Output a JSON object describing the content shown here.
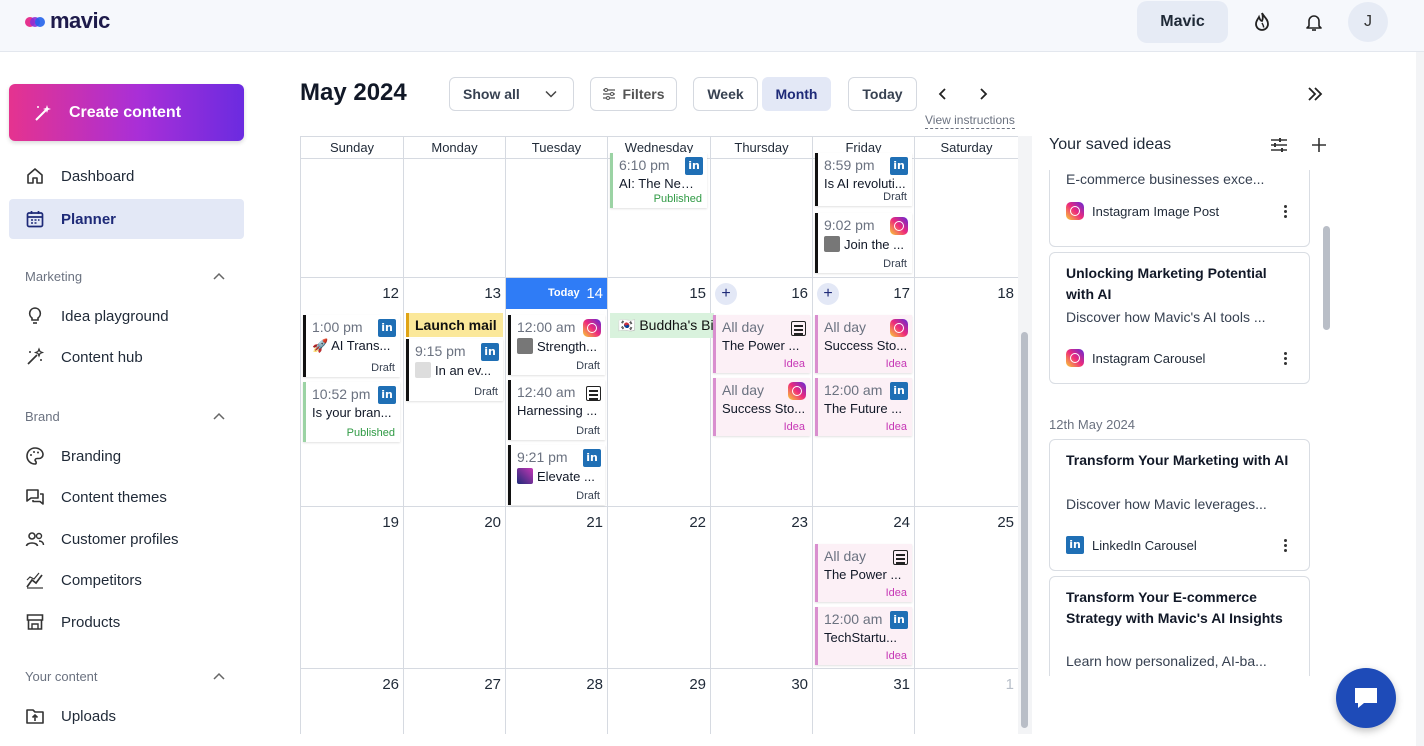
{
  "app": {
    "name": "mavic"
  },
  "topbar": {
    "brand_button": "Mavic",
    "avatar_initial": "J"
  },
  "sidebar": {
    "create_label": "Create content",
    "main_items": [
      {
        "label": "Dashboard"
      },
      {
        "label": "Planner"
      }
    ],
    "sections": [
      {
        "title": "Marketing",
        "items": [
          {
            "label": "Idea playground"
          },
          {
            "label": "Content hub"
          }
        ]
      },
      {
        "title": "Brand",
        "items": [
          {
            "label": "Branding"
          },
          {
            "label": "Content themes"
          },
          {
            "label": "Customer profiles"
          },
          {
            "label": "Competitors"
          },
          {
            "label": "Products"
          }
        ]
      },
      {
        "title": "Your content",
        "items": [
          {
            "label": "Uploads"
          }
        ]
      }
    ]
  },
  "calendar": {
    "title": "May 2024",
    "filter_select": "Show all",
    "filters_label": "Filters",
    "week_label": "Week",
    "month_label": "Month",
    "today_label": "Today",
    "view_instructions": "View instructions",
    "weekdays": [
      "Sunday",
      "Monday",
      "Tuesday",
      "Wednesday",
      "Thursday",
      "Friday",
      "Saturday"
    ],
    "today_tag": "Today",
    "days": {
      "d12": "12",
      "d13": "13",
      "d14": "14",
      "d15": "15",
      "d16": "16",
      "d17": "17",
      "d18": "18",
      "d19": "19",
      "d20": "20",
      "d21": "21",
      "d22": "22",
      "d23": "23",
      "d24": "24",
      "d25": "25",
      "d26": "26",
      "d27": "27",
      "d28": "28",
      "d29": "29",
      "d30": "30",
      "d31": "31",
      "d1": "1"
    },
    "plus": "+",
    "events": {
      "wed_pub": {
        "time": "6:10 pm",
        "title": "AI: The New ...",
        "status": "Published"
      },
      "fri_draft1": {
        "time": "8:59 pm",
        "title": "Is AI revoluti...",
        "status": "Draft"
      },
      "fri_draft2": {
        "time": "9:02 pm",
        "title": "Join the ...",
        "status": "Draft"
      },
      "sun12_a": {
        "time": "1:00 pm",
        "title": "🚀 AI Trans...",
        "status": "Draft"
      },
      "sun12_b": {
        "time": "10:52 pm",
        "title": "Is your bran...",
        "status": "Published"
      },
      "mon13_banner": {
        "title": "Launch mail"
      },
      "mon13_a": {
        "time": "9:15 pm",
        "title": "In an ev...",
        "status": "Draft"
      },
      "tue14_a": {
        "time": "12:00 am",
        "title": "Strength...",
        "status": "Draft"
      },
      "tue14_b": {
        "time": "12:40 am",
        "title": "Harnessing ...",
        "status": "Draft"
      },
      "tue14_c": {
        "time": "9:21 pm",
        "title": "Elevate ...",
        "status": "Draft"
      },
      "wed15_holiday": {
        "title": "🇰🇷 Buddha's Birthday"
      },
      "thu16_a": {
        "time": "All day",
        "title": "The Power ...",
        "status": "Idea"
      },
      "thu16_b": {
        "time": "All day",
        "title": "Success Sto...",
        "status": "Idea"
      },
      "fri17_a": {
        "time": "All day",
        "title": "Success Sto...",
        "status": "Idea"
      },
      "fri17_b": {
        "time": "12:00 am",
        "title": "The Future ...",
        "status": "Idea"
      },
      "fri24_a": {
        "time": "All day",
        "title": "The Power ...",
        "status": "Idea"
      },
      "fri24_b": {
        "time": "12:00 am",
        "title": "TechStartu...",
        "status": "Idea"
      }
    }
  },
  "saved_ideas": {
    "title": "Your saved ideas",
    "cards": [
      {
        "desc": "E-commerce businesses exce...",
        "platform": "Instagram Image Post"
      },
      {
        "title": "Unlocking Marketing Potential with AI",
        "desc": "Discover how Mavic's AI tools ...",
        "platform": "Instagram Carousel"
      },
      {
        "title": "Transform Your Marketing with AI",
        "desc": "Discover how Mavic leverages...",
        "platform": "LinkedIn Carousel"
      },
      {
        "title": "Transform Your E-commerce Strategy with Mavic's AI Insights",
        "desc": "Learn how personalized, AI-ba..."
      }
    ],
    "date_group": "12th May 2024"
  },
  "colors": {
    "accent": "#2f7cf6",
    "nav_active_bg": "#e3e8f6",
    "create_gradient_start": "#e5338f",
    "create_gradient_end": "#6b2be0",
    "linkedin": "#1f6fb5",
    "chat": "#1e4bb8"
  },
  "icons": [
    "mavic-logo-icon",
    "streak-flame-icon",
    "bell-icon",
    "magic-wand-icon",
    "home-icon",
    "calendar-icon",
    "lightbulb-icon",
    "sparkle-wand-icon",
    "palette-icon",
    "chat-bubbles-icon",
    "people-icon",
    "chart-icon",
    "store-icon",
    "upload-folder-icon",
    "chevron-up-icon",
    "chevron-down-icon",
    "filter-sliders-icon",
    "chevron-left-icon",
    "chevron-right-icon",
    "double-chevron-right-icon",
    "linkedin-icon",
    "instagram-icon",
    "document-icon",
    "plus-icon",
    "more-vertical-icon",
    "chat-icon"
  ]
}
